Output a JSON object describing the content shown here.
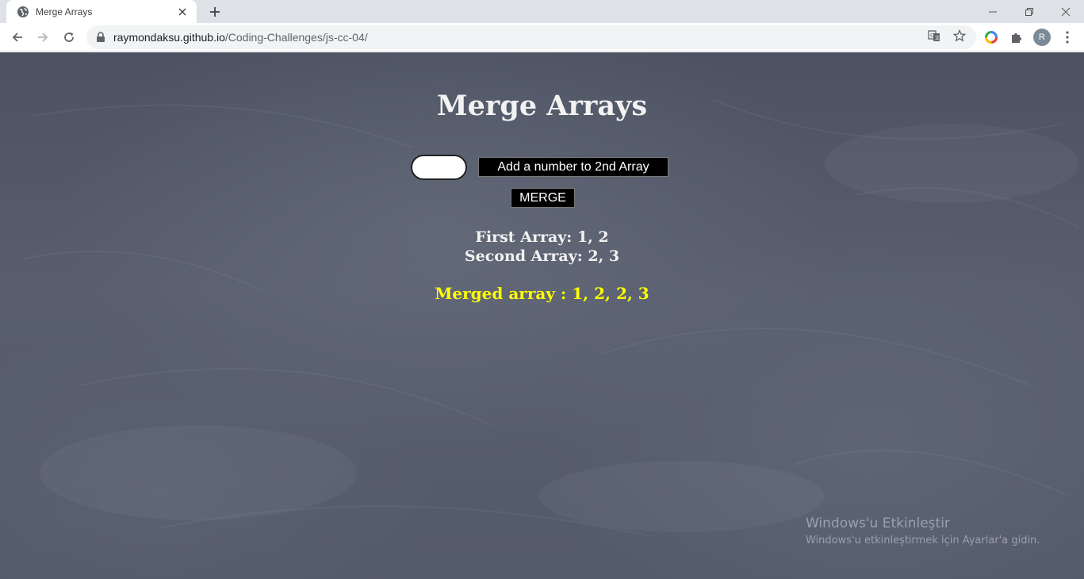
{
  "browser": {
    "tab_title": "Merge Arrays",
    "url_host": "raymondaksu.github.io",
    "url_path": "/Coding-Challenges/js-cc-04/",
    "profile_initial": "R",
    "icons": {
      "favicon": "globe-icon",
      "back": "back-arrow-icon",
      "forward": "forward-arrow-icon",
      "reload": "reload-icon",
      "lock": "lock-icon",
      "translate": "translate-icon",
      "bookmark": "star-icon",
      "extension_color": "color-wheel-icon",
      "extensions": "puzzle-icon",
      "menu": "kebab-menu-icon"
    }
  },
  "page": {
    "title": "Merge Arrays",
    "input_value": "",
    "add_button_label": "Add a number to 2nd Array",
    "merge_button_label": "MERGE",
    "first_array_text": "First Array: 1, 2",
    "second_array_text": "Second Array: 2, 3",
    "merged_text": "Merged array : 1, 2, 2, 3",
    "colors": {
      "background": "#555b6a",
      "text": "#f2f2f2",
      "merged": "#ffff00",
      "button": "#000000"
    }
  },
  "watermark": {
    "title": "Windows'u Etkinleştir",
    "subtitle": "Windows'u etkinleştirmek için Ayarlar'a gidin."
  }
}
